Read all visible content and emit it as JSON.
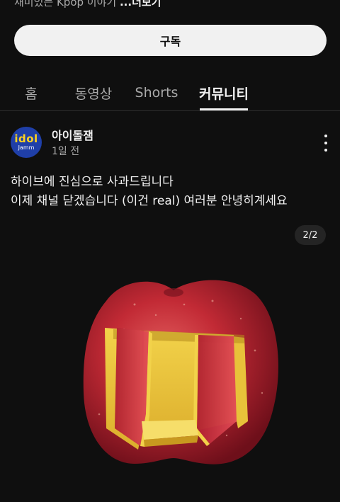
{
  "header": {
    "description_prefix": "재미있는 Kpop 이야기 ",
    "description_more": "...더보기",
    "subscribe_label": "구독"
  },
  "tabs": [
    {
      "label": "홈",
      "active": false
    },
    {
      "label": "동영상",
      "active": false
    },
    {
      "label": "Shorts",
      "active": false
    },
    {
      "label": "커뮤니티",
      "active": true
    }
  ],
  "post": {
    "avatar_text_top": "idol",
    "avatar_text_bottom": "Jamm",
    "channel_name": "아이돌잼",
    "time": "1일 전",
    "text_line1": "하이브에 진심으로 사과드립니다",
    "text_line2": "이제 채널 닫겠습니다 (이건 real) 여러분 안녕히계세요",
    "image_counter": "2/2",
    "menu_icon": "more-vertical-icon"
  },
  "colors": {
    "background": "#0f0f0f",
    "text_primary": "#f1f1f1",
    "text_secondary": "#aaaaaa",
    "avatar_bg": "#1f3fa8",
    "avatar_accent": "#ffd21e",
    "apple_red": "#c22a35"
  }
}
